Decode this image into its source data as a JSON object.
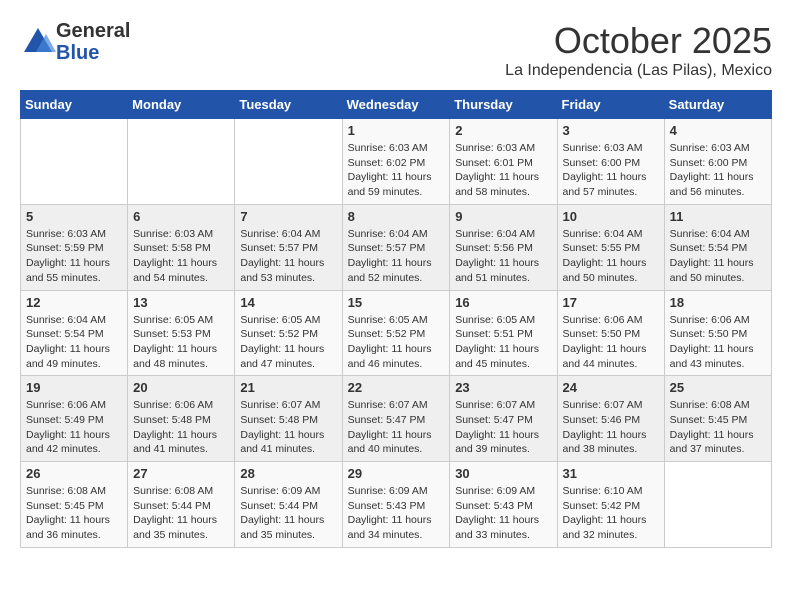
{
  "header": {
    "logo_general": "General",
    "logo_blue": "Blue",
    "title": "October 2025",
    "subtitle": "La Independencia (Las Pilas), Mexico"
  },
  "weekdays": [
    "Sunday",
    "Monday",
    "Tuesday",
    "Wednesday",
    "Thursday",
    "Friday",
    "Saturday"
  ],
  "weeks": [
    [
      {
        "day": "",
        "sunrise": "",
        "sunset": "",
        "daylight": ""
      },
      {
        "day": "",
        "sunrise": "",
        "sunset": "",
        "daylight": ""
      },
      {
        "day": "",
        "sunrise": "",
        "sunset": "",
        "daylight": ""
      },
      {
        "day": "1",
        "sunrise": "Sunrise: 6:03 AM",
        "sunset": "Sunset: 6:02 PM",
        "daylight": "Daylight: 11 hours and 59 minutes."
      },
      {
        "day": "2",
        "sunrise": "Sunrise: 6:03 AM",
        "sunset": "Sunset: 6:01 PM",
        "daylight": "Daylight: 11 hours and 58 minutes."
      },
      {
        "day": "3",
        "sunrise": "Sunrise: 6:03 AM",
        "sunset": "Sunset: 6:00 PM",
        "daylight": "Daylight: 11 hours and 57 minutes."
      },
      {
        "day": "4",
        "sunrise": "Sunrise: 6:03 AM",
        "sunset": "Sunset: 6:00 PM",
        "daylight": "Daylight: 11 hours and 56 minutes."
      }
    ],
    [
      {
        "day": "5",
        "sunrise": "Sunrise: 6:03 AM",
        "sunset": "Sunset: 5:59 PM",
        "daylight": "Daylight: 11 hours and 55 minutes."
      },
      {
        "day": "6",
        "sunrise": "Sunrise: 6:03 AM",
        "sunset": "Sunset: 5:58 PM",
        "daylight": "Daylight: 11 hours and 54 minutes."
      },
      {
        "day": "7",
        "sunrise": "Sunrise: 6:04 AM",
        "sunset": "Sunset: 5:57 PM",
        "daylight": "Daylight: 11 hours and 53 minutes."
      },
      {
        "day": "8",
        "sunrise": "Sunrise: 6:04 AM",
        "sunset": "Sunset: 5:57 PM",
        "daylight": "Daylight: 11 hours and 52 minutes."
      },
      {
        "day": "9",
        "sunrise": "Sunrise: 6:04 AM",
        "sunset": "Sunset: 5:56 PM",
        "daylight": "Daylight: 11 hours and 51 minutes."
      },
      {
        "day": "10",
        "sunrise": "Sunrise: 6:04 AM",
        "sunset": "Sunset: 5:55 PM",
        "daylight": "Daylight: 11 hours and 50 minutes."
      },
      {
        "day": "11",
        "sunrise": "Sunrise: 6:04 AM",
        "sunset": "Sunset: 5:54 PM",
        "daylight": "Daylight: 11 hours and 50 minutes."
      }
    ],
    [
      {
        "day": "12",
        "sunrise": "Sunrise: 6:04 AM",
        "sunset": "Sunset: 5:54 PM",
        "daylight": "Daylight: 11 hours and 49 minutes."
      },
      {
        "day": "13",
        "sunrise": "Sunrise: 6:05 AM",
        "sunset": "Sunset: 5:53 PM",
        "daylight": "Daylight: 11 hours and 48 minutes."
      },
      {
        "day": "14",
        "sunrise": "Sunrise: 6:05 AM",
        "sunset": "Sunset: 5:52 PM",
        "daylight": "Daylight: 11 hours and 47 minutes."
      },
      {
        "day": "15",
        "sunrise": "Sunrise: 6:05 AM",
        "sunset": "Sunset: 5:52 PM",
        "daylight": "Daylight: 11 hours and 46 minutes."
      },
      {
        "day": "16",
        "sunrise": "Sunrise: 6:05 AM",
        "sunset": "Sunset: 5:51 PM",
        "daylight": "Daylight: 11 hours and 45 minutes."
      },
      {
        "day": "17",
        "sunrise": "Sunrise: 6:06 AM",
        "sunset": "Sunset: 5:50 PM",
        "daylight": "Daylight: 11 hours and 44 minutes."
      },
      {
        "day": "18",
        "sunrise": "Sunrise: 6:06 AM",
        "sunset": "Sunset: 5:50 PM",
        "daylight": "Daylight: 11 hours and 43 minutes."
      }
    ],
    [
      {
        "day": "19",
        "sunrise": "Sunrise: 6:06 AM",
        "sunset": "Sunset: 5:49 PM",
        "daylight": "Daylight: 11 hours and 42 minutes."
      },
      {
        "day": "20",
        "sunrise": "Sunrise: 6:06 AM",
        "sunset": "Sunset: 5:48 PM",
        "daylight": "Daylight: 11 hours and 41 minutes."
      },
      {
        "day": "21",
        "sunrise": "Sunrise: 6:07 AM",
        "sunset": "Sunset: 5:48 PM",
        "daylight": "Daylight: 11 hours and 41 minutes."
      },
      {
        "day": "22",
        "sunrise": "Sunrise: 6:07 AM",
        "sunset": "Sunset: 5:47 PM",
        "daylight": "Daylight: 11 hours and 40 minutes."
      },
      {
        "day": "23",
        "sunrise": "Sunrise: 6:07 AM",
        "sunset": "Sunset: 5:47 PM",
        "daylight": "Daylight: 11 hours and 39 minutes."
      },
      {
        "day": "24",
        "sunrise": "Sunrise: 6:07 AM",
        "sunset": "Sunset: 5:46 PM",
        "daylight": "Daylight: 11 hours and 38 minutes."
      },
      {
        "day": "25",
        "sunrise": "Sunrise: 6:08 AM",
        "sunset": "Sunset: 5:45 PM",
        "daylight": "Daylight: 11 hours and 37 minutes."
      }
    ],
    [
      {
        "day": "26",
        "sunrise": "Sunrise: 6:08 AM",
        "sunset": "Sunset: 5:45 PM",
        "daylight": "Daylight: 11 hours and 36 minutes."
      },
      {
        "day": "27",
        "sunrise": "Sunrise: 6:08 AM",
        "sunset": "Sunset: 5:44 PM",
        "daylight": "Daylight: 11 hours and 35 minutes."
      },
      {
        "day": "28",
        "sunrise": "Sunrise: 6:09 AM",
        "sunset": "Sunset: 5:44 PM",
        "daylight": "Daylight: 11 hours and 35 minutes."
      },
      {
        "day": "29",
        "sunrise": "Sunrise: 6:09 AM",
        "sunset": "Sunset: 5:43 PM",
        "daylight": "Daylight: 11 hours and 34 minutes."
      },
      {
        "day": "30",
        "sunrise": "Sunrise: 6:09 AM",
        "sunset": "Sunset: 5:43 PM",
        "daylight": "Daylight: 11 hours and 33 minutes."
      },
      {
        "day": "31",
        "sunrise": "Sunrise: 6:10 AM",
        "sunset": "Sunset: 5:42 PM",
        "daylight": "Daylight: 11 hours and 32 minutes."
      },
      {
        "day": "",
        "sunrise": "",
        "sunset": "",
        "daylight": ""
      }
    ]
  ]
}
